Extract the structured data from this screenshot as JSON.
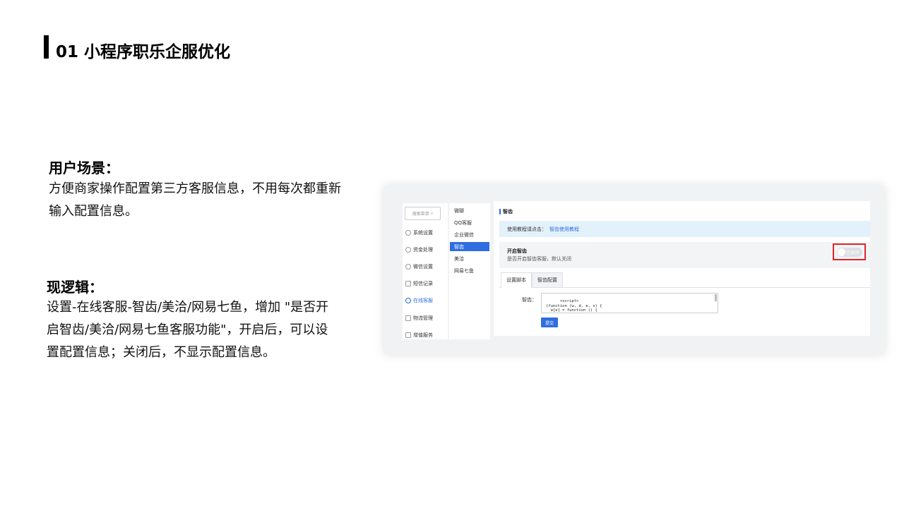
{
  "page_title": "01 小程序职乐企服优化",
  "scene": {
    "heading": "用户场景：",
    "lines": [
      "方便商家操作配置第三方客服信息，不用每次都重新",
      "输入配置信息。"
    ]
  },
  "logic": {
    "heading": "现逻辑：",
    "lines": [
      "设置-在线客服-智齿/美洽/网易七鱼，增加 \"是否开",
      "启智齿/美洽/网易七鱼客服功能\"，开启后，可以设",
      "置配置信息；关闭后，不显示配置信息。"
    ]
  },
  "screenshot": {
    "search_placeholder": "搜索菜单",
    "search_icon": "search-icon",
    "nav1": [
      {
        "label": "系统设置",
        "icon": "settings-icon"
      },
      {
        "label": "资金处理",
        "icon": "coin-icon"
      },
      {
        "label": "微信设置",
        "icon": "wechat-icon"
      },
      {
        "label": "短信记录",
        "icon": "mail-icon"
      },
      {
        "label": "在线客服",
        "icon": "headset-icon",
        "active": true
      },
      {
        "label": "物流管理",
        "icon": "truck-icon"
      },
      {
        "label": "增值服务",
        "icon": "chart-icon"
      }
    ],
    "nav2": [
      {
        "label": "微聊"
      },
      {
        "label": "QQ客服"
      },
      {
        "label": "企业微信"
      },
      {
        "label": "智齿",
        "active": true
      },
      {
        "label": "美洽"
      },
      {
        "label": "网易七鱼"
      }
    ],
    "main_title": "智齿",
    "tip_text": "使用教程请点击：",
    "tip_link": "智齿使用教程",
    "toggle_title": "开启智齿",
    "toggle_desc": "是否开启智齿客服，默认关闭",
    "toggle_state": "已关闭",
    "tabs": [
      {
        "label": "设置脚本",
        "active": true
      },
      {
        "label": "智齿配置",
        "active": false
      }
    ],
    "field_label": "智齿：",
    "code_text": "<script>\n(function (w, d, e, x) {\n  w[e] = function () {\n    w.cbk = w.cbk || [];",
    "submit_label": "提交",
    "accent_color": "#2f6ee0",
    "highlight_color": "#e0252b"
  }
}
